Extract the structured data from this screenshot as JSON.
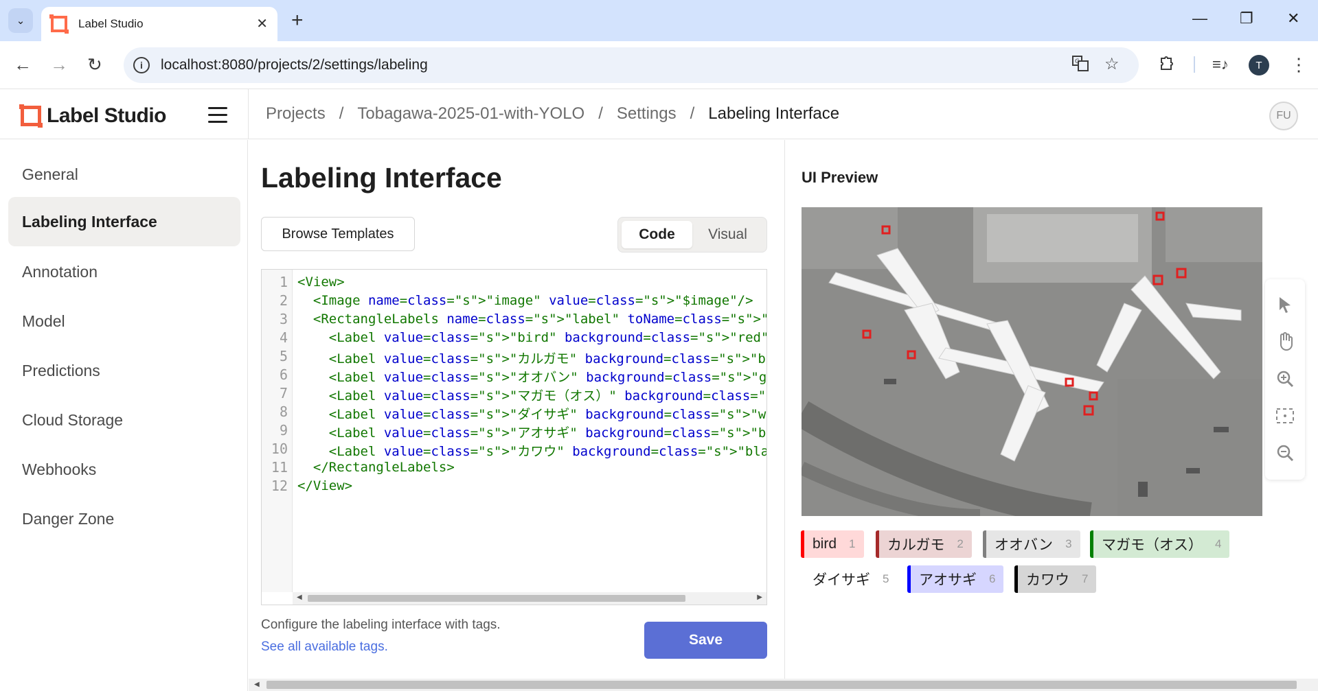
{
  "browser": {
    "tab_title": "Label Studio",
    "url": "localhost:8080/projects/2/settings/labeling",
    "profile_initial": "T"
  },
  "app": {
    "logo_text": "Label Studio",
    "user_initials": "FU"
  },
  "breadcrumb": [
    "Projects",
    "Tobagawa-2025-01-with-YOLO",
    "Settings",
    "Labeling Interface"
  ],
  "sidebar": {
    "items": [
      {
        "label": "General"
      },
      {
        "label": "Labeling Interface",
        "active": true
      },
      {
        "label": "Annotation"
      },
      {
        "label": "Model"
      },
      {
        "label": "Predictions"
      },
      {
        "label": "Cloud Storage"
      },
      {
        "label": "Webhooks"
      },
      {
        "label": "Danger Zone"
      }
    ]
  },
  "main": {
    "title": "Labeling Interface",
    "browse_templates": "Browse Templates",
    "toggle": {
      "code": "Code",
      "visual": "Visual",
      "selected": "Code"
    },
    "code_lines": [
      "<View>",
      "  <Image name=\"image\" value=\"$image\"/>",
      "  <RectangleLabels name=\"label\" toName=\"image\" model_score_thresho",
      "    <Label value=\"bird\" background=\"red\"/>",
      "    <Label value=\"カルガモ\" background=\"brown\"/>",
      "    <Label value=\"オオバン\" background=\"gray\"/>",
      "    <Label value=\"マガモ（オス）\" background=\"green\"/>",
      "    <Label value=\"ダイサギ\" background=\"white\"/>",
      "    <Label value=\"アオサギ\" background=\"blue\"/>",
      "    <Label value=\"カワウ\" background=\"black\"/>",
      "  </RectangleLabels>",
      "</View>"
    ],
    "line_numbers": [
      "1",
      "2",
      "3",
      "4",
      "5",
      "6",
      "7",
      "8",
      "9",
      "10",
      "11",
      "12"
    ],
    "help_text": "Configure the labeling interface with tags.",
    "help_link": "See all available tags.",
    "save_label": "Save"
  },
  "preview": {
    "title": "UI Preview",
    "image_icon": "aerial-airport-photo",
    "tools": [
      "cursor-icon",
      "hand-icon",
      "zoom-in-icon",
      "fit-icon",
      "zoom-out-icon"
    ],
    "labels": [
      {
        "text": "bird",
        "hotkey": "1",
        "color": "#ff0000",
        "bg": "#ffd9d9"
      },
      {
        "text": "カルガモ",
        "hotkey": "2",
        "color": "#a52a2a",
        "bg": "#ecd4d4"
      },
      {
        "text": "オオバン",
        "hotkey": "3",
        "color": "#808080",
        "bg": "#e6e6e6"
      },
      {
        "text": "マガモ（オス）",
        "hotkey": "4",
        "color": "#008000",
        "bg": "#d3ead3"
      },
      {
        "text": "ダイサギ",
        "hotkey": "5",
        "color": "#ffffff",
        "bg": "#ffffff"
      },
      {
        "text": "アオサギ",
        "hotkey": "6",
        "color": "#0000ff",
        "bg": "#d6d6ff"
      },
      {
        "text": "カワウ",
        "hotkey": "7",
        "color": "#000000",
        "bg": "#d6d6d6"
      }
    ]
  }
}
